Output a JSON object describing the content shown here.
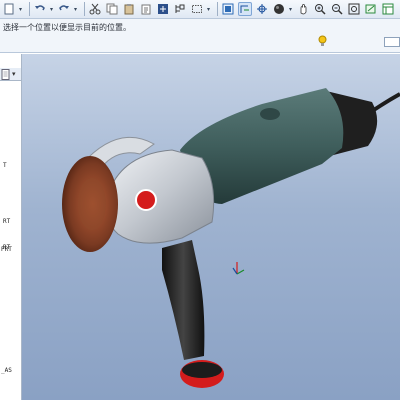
{
  "toolbar": {
    "icons": [
      "new-icon",
      "open-icon",
      "undo-icon",
      "redo-icon",
      "cut-icon",
      "copy-icon",
      "paste-icon",
      "paste-special-icon",
      "regenerate-icon",
      "model-tree-icon",
      "select-box-icon",
      "view-refit-icon",
      "orient-icon",
      "spin-center-icon",
      "shade-icon",
      "pan-icon",
      "zoom-in-icon",
      "zoom-out-icon",
      "refit-icon",
      "datum-icon",
      "view-manager-icon"
    ]
  },
  "message": {
    "text": "选择一个位置以便显示目前的位置。"
  },
  "sidebar": {
    "labels": [
      "T",
      "RT",
      "RT",
      "PRT",
      "_AS"
    ]
  },
  "colors": {
    "viewport_top": "#c6d3e6",
    "viewport_bottom": "#8aa1c4",
    "motor_housing": "#3f5e5c",
    "gear_head": "#c9cdd3",
    "disc": "#7a3a22",
    "handle": "#222222",
    "accent_red": "#d41c1c"
  }
}
